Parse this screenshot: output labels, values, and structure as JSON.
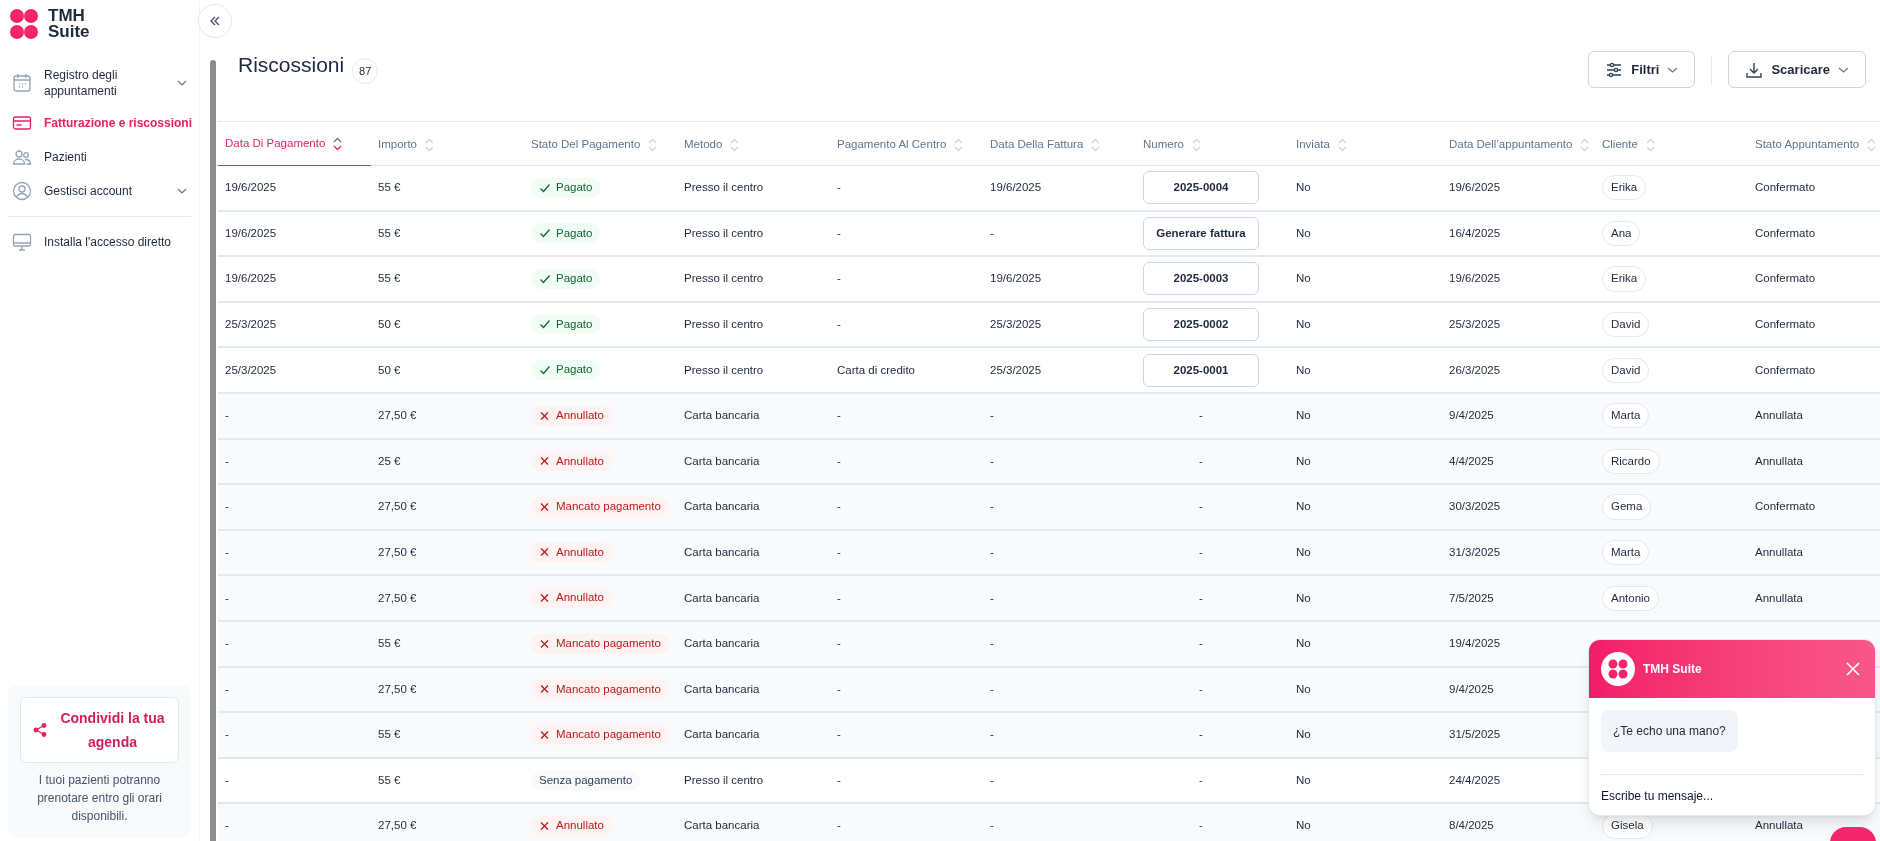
{
  "logo": {
    "line1": "TMH",
    "line2": "Suite"
  },
  "sidebar": {
    "items": [
      {
        "label": "Registro degli appuntamenti",
        "selected": false,
        "expanded": false
      },
      {
        "label": "Fatturazione e riscossioni",
        "selected": true
      },
      {
        "label": "Pazienti",
        "selected": false
      },
      {
        "label": "Gestisci account",
        "selected": false,
        "expanded": false
      }
    ],
    "extra_items": [
      {
        "label": "Installa l'accesso diretto",
        "selected": false
      }
    ],
    "share_card": {
      "button": "Condividi la tua agenda",
      "text": "I tuoi pazienti potranno prenotare entro gli orari disponibili."
    }
  },
  "page": {
    "title": "Riscossioni",
    "count": "87",
    "buttons": [
      {
        "label": "Filtri"
      },
      {
        "label": "Scaricare"
      }
    ]
  },
  "table": {
    "columns": [
      {
        "label": "Data Di Pagamento",
        "selected": true
      },
      {
        "label": "Importo",
        "selected": false
      },
      {
        "label": "Stato Del Pagamento",
        "selected": false
      },
      {
        "label": "Metodo",
        "selected": false
      },
      {
        "label": "Pagamento Al Centro",
        "selected": false
      },
      {
        "label": "Data Della Fattura",
        "selected": false
      },
      {
        "label": "Numero",
        "selected": false
      },
      {
        "label": "Inviata",
        "selected": false
      },
      {
        "label": "Data Dell’appuntamento",
        "selected": false
      },
      {
        "label": "Cliente",
        "selected": false
      },
      {
        "label": "Stato Appuntamento",
        "selected": false
      }
    ],
    "rows": [
      {
        "payment_date": "19/6/2025",
        "amount": "55 €",
        "status": {
          "kind": "paid",
          "label": "Pagato"
        },
        "method": "Presso il centro",
        "at_center": "-",
        "invoice_date": "19/6/2025",
        "number": {
          "kind": "button",
          "text": "2025-0004"
        },
        "sent": "No",
        "appointment_date": "19/6/2025",
        "client": "Erika",
        "appointment_status": "Confermato"
      },
      {
        "payment_date": "19/6/2025",
        "amount": "55 €",
        "status": {
          "kind": "paid",
          "label": "Pagato"
        },
        "method": "Presso il centro",
        "at_center": "-",
        "invoice_date": "-",
        "number": {
          "kind": "button",
          "text": "Generare fattura"
        },
        "sent": "No",
        "appointment_date": "16/4/2025",
        "client": "Ana",
        "appointment_status": "Confermato"
      },
      {
        "payment_date": "19/6/2025",
        "amount": "55 €",
        "status": {
          "kind": "paid",
          "label": "Pagato"
        },
        "method": "Presso il centro",
        "at_center": "-",
        "invoice_date": "19/6/2025",
        "number": {
          "kind": "button",
          "text": "2025-0003"
        },
        "sent": "No",
        "appointment_date": "19/6/2025",
        "client": "Erika",
        "appointment_status": "Confermato"
      },
      {
        "payment_date": "25/3/2025",
        "amount": "50 €",
        "status": {
          "kind": "paid",
          "label": "Pagato"
        },
        "method": "Presso il centro",
        "at_center": "-",
        "invoice_date": "25/3/2025",
        "number": {
          "kind": "button",
          "text": "2025-0002"
        },
        "sent": "No",
        "appointment_date": "25/3/2025",
        "client": "David",
        "appointment_status": "Confermato"
      },
      {
        "payment_date": "25/3/2025",
        "amount": "50 €",
        "status": {
          "kind": "paid",
          "label": "Pagato"
        },
        "method": "Presso il centro",
        "at_center": "Carta di credito",
        "invoice_date": "25/3/2025",
        "number": {
          "kind": "button",
          "text": "2025-0001"
        },
        "sent": "No",
        "appointment_date": "26/3/2025",
        "client": "David",
        "appointment_status": "Confermato"
      },
      {
        "payment_date": "-",
        "amount": "27,50 €",
        "status": {
          "kind": "failed",
          "label": "Annullato"
        },
        "method": "Carta bancaria",
        "at_center": "-",
        "invoice_date": "-",
        "number": {
          "kind": "text",
          "text": "-"
        },
        "sent": "No",
        "appointment_date": "9/4/2025",
        "client": "Marta",
        "appointment_status": "Annullata"
      },
      {
        "payment_date": "-",
        "amount": "25 €",
        "status": {
          "kind": "failed",
          "label": "Annullato"
        },
        "method": "Carta bancaria",
        "at_center": "-",
        "invoice_date": "-",
        "number": {
          "kind": "text",
          "text": "-"
        },
        "sent": "No",
        "appointment_date": "4/4/2025",
        "client": "Ricardo",
        "appointment_status": "Annullata"
      },
      {
        "payment_date": "-",
        "amount": "27,50 €",
        "status": {
          "kind": "failed",
          "label": "Mancato pagamento"
        },
        "method": "Carta bancaria",
        "at_center": "-",
        "invoice_date": "-",
        "number": {
          "kind": "text",
          "text": "-"
        },
        "sent": "No",
        "appointment_date": "30/3/2025",
        "client": "Gema",
        "appointment_status": "Confermato"
      },
      {
        "payment_date": "-",
        "amount": "27,50 €",
        "status": {
          "kind": "failed",
          "label": "Annullato"
        },
        "method": "Carta bancaria",
        "at_center": "-",
        "invoice_date": "-",
        "number": {
          "kind": "text",
          "text": "-"
        },
        "sent": "No",
        "appointment_date": "31/3/2025",
        "client": "Marta",
        "appointment_status": "Annullata"
      },
      {
        "payment_date": "-",
        "amount": "27,50 €",
        "status": {
          "kind": "failed",
          "label": "Annullato"
        },
        "method": "Carta bancaria",
        "at_center": "-",
        "invoice_date": "-",
        "number": {
          "kind": "text",
          "text": "-"
        },
        "sent": "No",
        "appointment_date": "7/5/2025",
        "client": "Antonio",
        "appointment_status": "Annullata"
      },
      {
        "payment_date": "-",
        "amount": "55 €",
        "status": {
          "kind": "failed",
          "label": "Mancato pagamento"
        },
        "method": "Carta bancaria",
        "at_center": "-",
        "invoice_date": "-",
        "number": {
          "kind": "text",
          "text": "-"
        },
        "sent": "No",
        "appointment_date": "19/4/2025"
      },
      {
        "payment_date": "-",
        "amount": "27,50 €",
        "status": {
          "kind": "failed",
          "label": "Mancato pagamento"
        },
        "method": "Carta bancaria",
        "at_center": "-",
        "invoice_date": "-",
        "number": {
          "kind": "text",
          "text": "-"
        },
        "sent": "No",
        "appointment_date": "9/4/2025"
      },
      {
        "payment_date": "-",
        "amount": "55 €",
        "status": {
          "kind": "failed",
          "label": "Mancato pagamento"
        },
        "method": "Carta bancaria",
        "at_center": "-",
        "invoice_date": "-",
        "number": {
          "kind": "text",
          "text": "-"
        },
        "sent": "No",
        "appointment_date": "31/5/2025"
      },
      {
        "payment_date": "-",
        "amount": "55 €",
        "status": {
          "kind": "none",
          "label": "Senza pagamento"
        },
        "method": "Presso il centro",
        "at_center": "-",
        "invoice_date": "-",
        "number": {
          "kind": "text",
          "text": "-"
        },
        "sent": "No",
        "appointment_date": "24/4/2025"
      },
      {
        "payment_date": "-",
        "amount": "27,50 €",
        "status": {
          "kind": "failed",
          "label": "Annullato"
        },
        "method": "Carta bancaria",
        "at_center": "-",
        "invoice_date": "-",
        "number": {
          "kind": "text",
          "text": "-"
        },
        "sent": "No",
        "appointment_date": "8/4/2025",
        "client": "Gisela",
        "appointment_status": "Annullata"
      }
    ]
  },
  "chat": {
    "title": "TMH Suite",
    "message": "¿Te echo una mano?",
    "placeholder": "Escribe tu mensaje..."
  }
}
